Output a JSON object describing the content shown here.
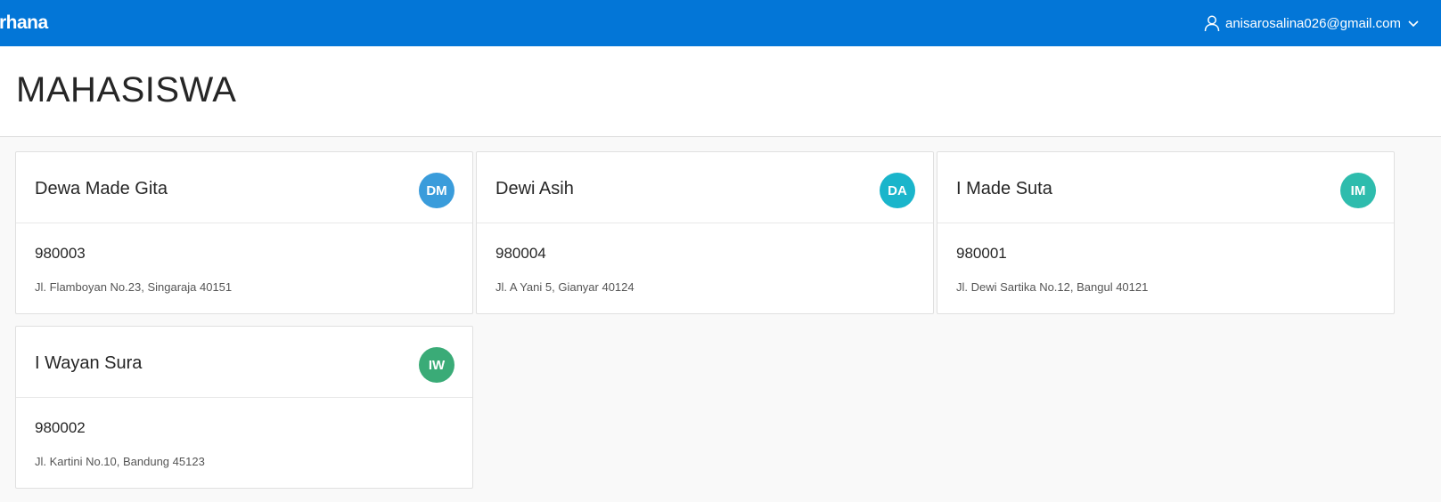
{
  "header": {
    "app_name": "rhana",
    "user_email": "anisarosalina026@gmail.com",
    "user_icon": "user-icon",
    "dropdown_icon": "chevron-down-icon",
    "background_color": "#0376d7"
  },
  "page": {
    "title": "MAHASISWA"
  },
  "cards": [
    {
      "name": "Dewa Made Gita",
      "initials": "DM",
      "id": "980003",
      "address": "Jl. Flamboyan No.23, Singaraja 40151",
      "avatar_color": "#3a9cdb"
    },
    {
      "name": "Dewi Asih",
      "initials": "DA",
      "id": "980004",
      "address": "Jl. A Yani 5, Gianyar 40124",
      "avatar_color": "#1ab5cb"
    },
    {
      "name": "I Made Suta",
      "initials": "IM",
      "id": "980001",
      "address": "Jl. Dewi Sartika No.12, Bangul 40121",
      "avatar_color": "#2ebcad"
    },
    {
      "name": "I Wayan Sura",
      "initials": "IW",
      "id": "980002",
      "address": "Jl. Kartini No.10, Bandung 45123",
      "avatar_color": "#3aab77"
    }
  ]
}
